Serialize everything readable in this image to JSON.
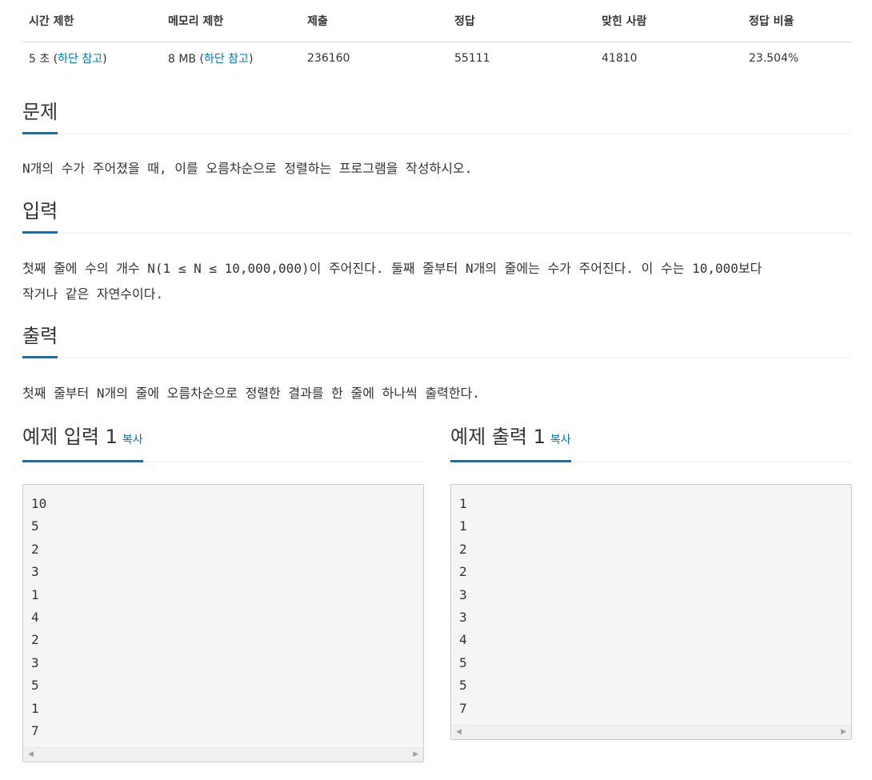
{
  "stats": {
    "headers": [
      "시간 제한",
      "메모리 제한",
      "제출",
      "정답",
      "맞힌 사람",
      "정답 비율"
    ],
    "time_limit": {
      "value": "5 초",
      "open_paren": " (",
      "link": "하단 참고",
      "close_paren": ")"
    },
    "memory_limit": {
      "value": "8 MB",
      "open_paren": " (",
      "link": "하단 참고",
      "close_paren": ")"
    },
    "submissions": "236160",
    "correct": "55111",
    "solvers": "41810",
    "ratio": "23.504%"
  },
  "problem": {
    "title": "문제",
    "text": "N개의 수가 주어졌을 때, 이를 오름차순으로 정렬하는 프로그램을 작성하시오."
  },
  "input": {
    "title": "입력",
    "line1": "첫째 줄에 수의 개수 N(1 ≤ N ≤ 10,000,000)이 주어진다. 둘째 줄부터 N개의 줄에는 수가 주어진다. 이 수는 10,000보다",
    "line2": "작거나 같은 자연수이다."
  },
  "output": {
    "title": "출력",
    "text": "첫째 줄부터 N개의 줄에 오름차순으로 정렬한 결과를 한 줄에 하나씩 출력한다."
  },
  "example_input": {
    "title": "예제 입력 1",
    "copy_label": "복사",
    "lines": [
      "10",
      "5",
      "2",
      "3",
      "1",
      "4",
      "2",
      "3",
      "5",
      "1",
      "7"
    ]
  },
  "example_output": {
    "title": "예제 출력 1",
    "copy_label": "복사",
    "lines": [
      "1",
      "1",
      "2",
      "2",
      "3",
      "3",
      "4",
      "5",
      "5",
      "7"
    ]
  },
  "colors": {
    "accent": "#0076c0",
    "text": "#333333",
    "code_bg": "#f5f5f5"
  },
  "icons": {
    "scroll_left": "◀",
    "scroll_right": "▶"
  }
}
